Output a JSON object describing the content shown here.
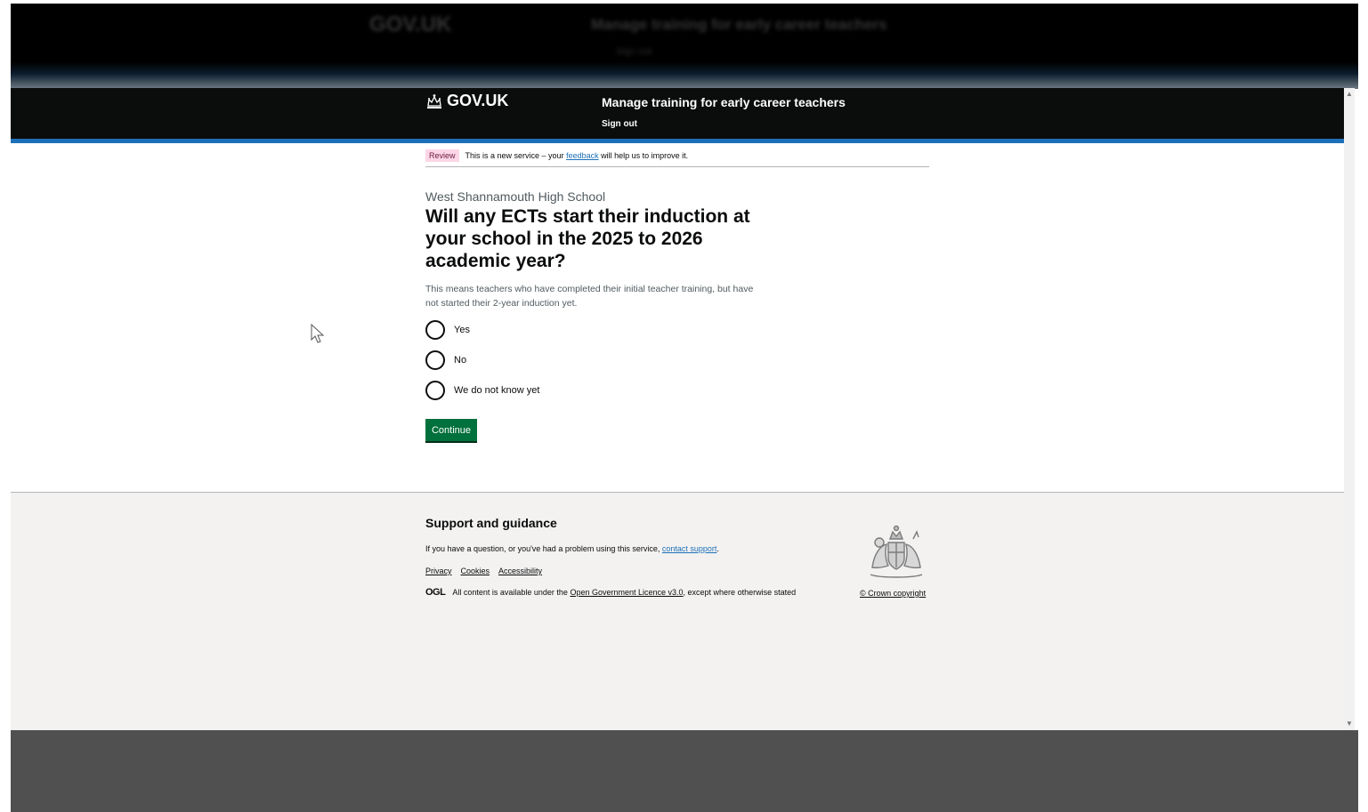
{
  "ghost_header": {
    "logo": "GOV.UK",
    "service_name": "Manage training for early career teachers",
    "sign_out": "Sign out"
  },
  "header": {
    "logo_text": "GOV.UK",
    "service_name": "Manage training for early career teachers",
    "sign_out": "Sign out"
  },
  "phase_banner": {
    "tag": "Review",
    "text_before": "This is a new service – your",
    "link": "feedback",
    "text_after": "will help us to improve it."
  },
  "question": {
    "caption": "West Shannamouth High School",
    "heading": "Will any ECTs start their induction at your school in the 2025 to 2026 academic year?",
    "hint": "This means teachers who have completed their initial teacher training, but have not started their 2-year induction yet.",
    "options": [
      {
        "label": "Yes"
      },
      {
        "label": "No"
      },
      {
        "label": "We do not know yet"
      }
    ],
    "continue_label": "Continue"
  },
  "footer": {
    "heading": "Support and guidance",
    "support_text": "If you have a question, or you've had a problem using this service,",
    "support_link": "contact support",
    "support_end": ".",
    "links": [
      "Privacy",
      "Cookies",
      "Accessibility"
    ],
    "ogl_logo": "OGL",
    "licence_before": "All content is available under the",
    "licence_link": "Open Government Licence v3.0",
    "licence_after": ", except where otherwise stated",
    "crown_copyright": "© Crown copyright"
  },
  "colors": {
    "header_bg": "#0b0c0c",
    "header_border": "#1d70b8",
    "button": "#00703c",
    "link": "#1d70b8",
    "footer_bg": "#f3f2f1",
    "tag_bg": "#fcd6e6"
  }
}
